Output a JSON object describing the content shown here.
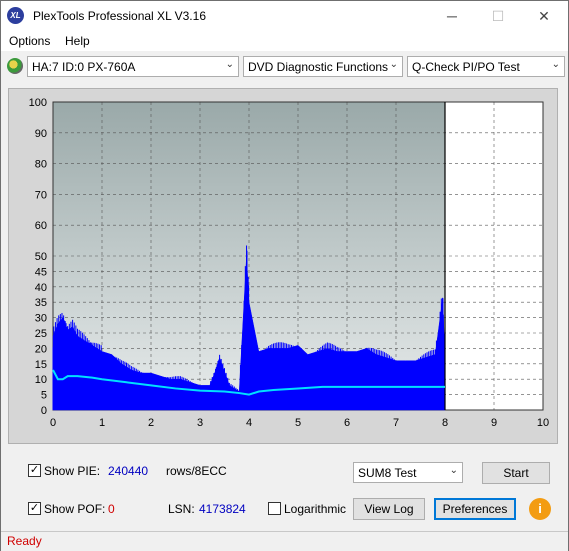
{
  "window": {
    "title": "PlexTools Professional XL V3.16",
    "icon_text": "XL",
    "minimize": "─",
    "maximize": "☐",
    "close": "✕"
  },
  "menu": {
    "items": [
      "Options",
      "Help"
    ]
  },
  "toolbar": {
    "drive": "HA:7 ID:0  PX-760A",
    "function": "DVD Diagnostic Functions",
    "test": "Q-Check PI/PO Test"
  },
  "chart_data": {
    "type": "bar",
    "xlim": [
      0,
      10
    ],
    "ylim": [
      0,
      100
    ],
    "x_ticks": [
      "0",
      "1",
      "2",
      "3",
      "4",
      "5",
      "6",
      "7",
      "8",
      "9",
      "10"
    ],
    "y_ticks": [
      "0",
      "5",
      "10",
      "15",
      "20",
      "25",
      "30",
      "35",
      "40",
      "45",
      "50",
      "60",
      "70",
      "80",
      "90",
      "100"
    ],
    "data_end_x": 8,
    "grid": true,
    "series": [
      {
        "color": "#0000ff",
        "x": [
          0.0,
          0.1,
          0.2,
          0.3,
          0.4,
          0.5,
          0.6,
          0.7,
          0.8,
          0.9,
          1.0,
          1.2,
          1.4,
          1.6,
          1.8,
          2.0,
          2.2,
          2.4,
          2.6,
          2.8,
          3.0,
          3.2,
          3.3,
          3.4,
          3.6,
          3.8,
          3.95,
          4.0,
          4.2,
          4.4,
          4.6,
          4.8,
          5.0,
          5.2,
          5.4,
          5.6,
          5.8,
          6.0,
          6.2,
          6.4,
          6.6,
          6.8,
          7.0,
          7.2,
          7.4,
          7.6,
          7.8,
          7.95,
          8.0
        ],
        "values": [
          24,
          28,
          30,
          26,
          27,
          24,
          23,
          22,
          21,
          20,
          19,
          18,
          15,
          13,
          12,
          12,
          11,
          10,
          10,
          9,
          8,
          8,
          12,
          17,
          8,
          6,
          50,
          35,
          19,
          20,
          20,
          20,
          21,
          18,
          19,
          20,
          19,
          19,
          19,
          20,
          18,
          17,
          16,
          16,
          16,
          17,
          18,
          36,
          18
        ]
      },
      {
        "color": "#00e0ff",
        "x": [
          0.0,
          0.1,
          0.2,
          0.3,
          0.5,
          0.8,
          1.0,
          1.5,
          2.0,
          2.5,
          3.0,
          3.5,
          3.8,
          4.0,
          4.2,
          4.5,
          5.0,
          5.5,
          6.0,
          6.5,
          7.0,
          7.5,
          8.0
        ],
        "values": [
          13,
          10,
          10,
          11,
          11,
          10.5,
          10,
          9,
          8,
          7,
          6.3,
          6,
          5.5,
          5,
          6,
          6.5,
          7,
          7.5,
          7.5,
          7.5,
          7.5,
          7.5,
          7.5
        ]
      }
    ]
  },
  "controls": {
    "show_pie_label": "Show PIE:",
    "pie_value": "240440",
    "pie_unit": "rows/8ECC",
    "show_pof_label": "Show POF:",
    "pof_value": "0",
    "lsn_label": "LSN:",
    "lsn_value": "4173824",
    "log_label": "Logarithmic",
    "sum8_option": "SUM8 Test",
    "start_label": "Start",
    "viewlog_label": "View Log",
    "prefs_label": "Preferences",
    "info_glyph": "i",
    "check_glyph": "✓"
  },
  "status": {
    "text": "Ready"
  }
}
